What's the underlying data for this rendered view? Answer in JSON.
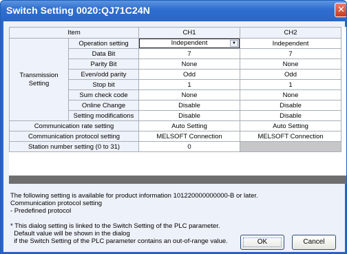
{
  "window": {
    "title": "Switch Setting 0020:QJ71C24N",
    "close_glyph": "✕"
  },
  "grid": {
    "headers": {
      "item": "Item",
      "ch1": "CH1",
      "ch2": "CH2"
    },
    "transmission": {
      "label_line1": "Transmission",
      "label_line2": "Setting"
    },
    "rows": [
      {
        "label": "Operation setting",
        "ch1": "Independent",
        "ch2": "Independent"
      },
      {
        "label": "Data Bit",
        "ch1": "7",
        "ch2": "7"
      },
      {
        "label": "Parity Bit",
        "ch1": "None",
        "ch2": "None"
      },
      {
        "label": "Even/odd parity",
        "ch1": "Odd",
        "ch2": "Odd"
      },
      {
        "label": "Stop bit",
        "ch1": "1",
        "ch2": "1"
      },
      {
        "label": "Sum check code",
        "ch1": "None",
        "ch2": "None"
      },
      {
        "label": "Online Change",
        "ch1": "Disable",
        "ch2": "Disable"
      },
      {
        "label": "Setting modifications",
        "ch1": "Disable",
        "ch2": "Disable"
      }
    ],
    "wide_rows": [
      {
        "label": "Communication rate setting",
        "ch1": "Auto Setting",
        "ch2": "Auto Setting"
      },
      {
        "label": "Communication protocol setting",
        "ch1": "MELSOFT Connection",
        "ch2": "MELSOFT Connection"
      },
      {
        "label": "Station number setting (0 to 31)",
        "ch1": "0",
        "ch2": ""
      }
    ],
    "dropdown_arrow_glyph": "▼"
  },
  "notes": {
    "line1": "The following setting is available for product information 101220000000000-B or later.",
    "line2": "Communication protocol setting",
    "line3": "- Predefined protocol",
    "line4": "* This dialog setting is linked to the Switch Setting of the PLC parameter.",
    "line5": "  Default value will be shown in the dialog",
    "line6": "  if the Switch Setting of the PLC parameter contains an out-of-range value."
  },
  "buttons": {
    "ok": "OK",
    "cancel": "Cancel"
  }
}
